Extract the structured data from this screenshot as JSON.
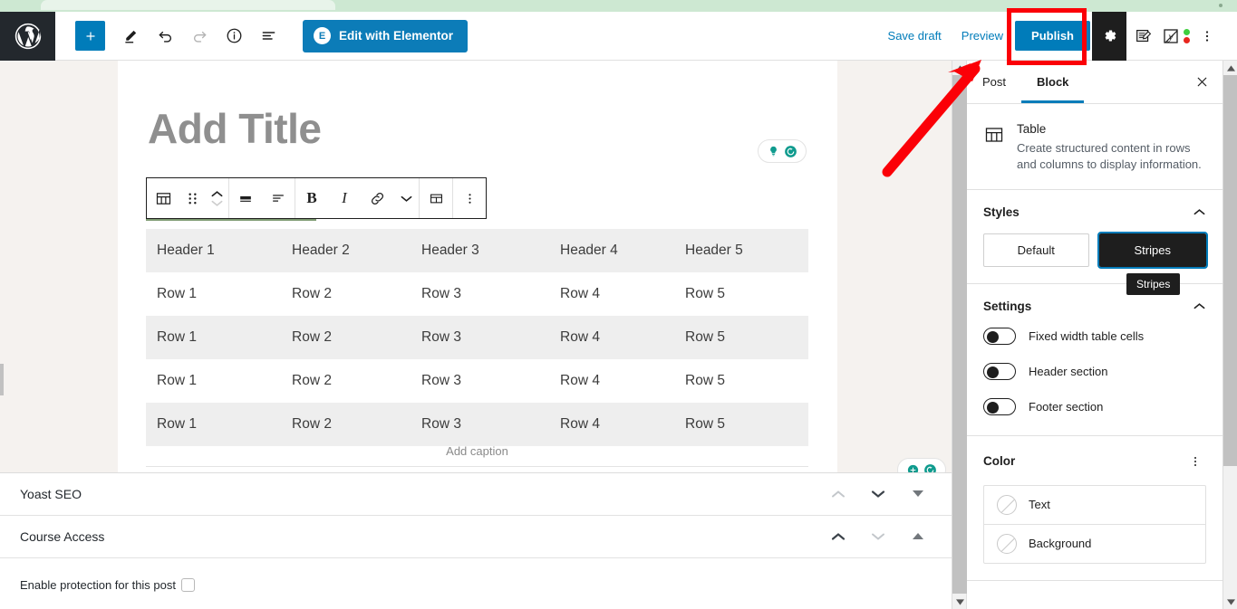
{
  "topbar": {
    "logo_icon": "wordpress-logo-icon",
    "add_block_label": "+",
    "tools": [
      {
        "name": "add-block-button",
        "icon": "plus-icon"
      },
      {
        "name": "tools-pencil-button",
        "icon": "pencil-icon"
      },
      {
        "name": "undo-button",
        "icon": "undo-arrow-icon"
      },
      {
        "name": "redo-button",
        "icon": "redo-arrow-icon"
      },
      {
        "name": "details-button",
        "icon": "info-circle-icon"
      },
      {
        "name": "list-view-button",
        "icon": "list-view-icon"
      }
    ],
    "elementor_label": "Edit with Elementor",
    "elementor_badge": "E",
    "save_draft_label": "Save draft",
    "preview_label": "Preview",
    "publish_label": "Publish",
    "settings_icon": "gear-icon",
    "edit_icon": "edit-note-icon",
    "yoast_icon": "yoast-seo-icon",
    "more_icon": "three-dots-vertical-icon",
    "publish_color": "#007cba",
    "elementor_color": "#0c7cb8"
  },
  "annotation": {
    "highlight_color": "#fb0007",
    "box_target": "publish-button",
    "arrow_points_to": "block-tab"
  },
  "editor": {
    "title_placeholder": "Add Title",
    "caption_placeholder": "Add caption",
    "title_assist_icons": [
      "lightbulb-icon",
      "refresh-circle-icon"
    ],
    "bottom_assist_icons": [
      "plus-circle-icon",
      "refresh-circle-icon"
    ],
    "block_toolbar": [
      {
        "name": "block-type-table-button",
        "icon": "table-icon"
      },
      {
        "name": "drag-handle",
        "icon": "drag-dots-icon"
      },
      {
        "name": "move-block-updown-button",
        "icon": "chevron-up-down-icon"
      },
      {
        "name": "align-button",
        "icon": "align-icon"
      },
      {
        "name": "text-align-button",
        "icon": "text-align-icon"
      },
      {
        "name": "bold-button",
        "icon": "bold-icon",
        "label": "B"
      },
      {
        "name": "italic-button",
        "icon": "italic-icon",
        "label": "I"
      },
      {
        "name": "link-button",
        "icon": "link-chain-icon"
      },
      {
        "name": "more-rich-text-button",
        "icon": "chevron-down-icon"
      },
      {
        "name": "edit-table-button",
        "icon": "table-grid-icon"
      },
      {
        "name": "block-options-button",
        "icon": "three-dots-vertical-icon"
      }
    ]
  },
  "table": {
    "headers": [
      "Header 1",
      "Header 2",
      "Header 3",
      "Header 4",
      "Header 5"
    ],
    "rows": [
      [
        "Row 1",
        "Row 2",
        "Row 3",
        "Row 4",
        "Row 5"
      ],
      [
        "Row 1",
        "Row 2",
        "Row 3",
        "Row 4",
        "Row 5"
      ],
      [
        "Row 1",
        "Row 2",
        "Row 3",
        "Row 4",
        "Row 5"
      ],
      [
        "Row 1",
        "Row 2",
        "Row 3",
        "Row 4",
        "Row 5"
      ]
    ],
    "stripe_color": "#eeeeee"
  },
  "meta_panels": [
    {
      "title": "Yoast SEO",
      "controls": [
        "move-up-icon",
        "move-down-icon",
        "toggle-open-icon"
      ]
    },
    {
      "title": "Course Access",
      "controls": [
        "move-up-icon",
        "move-down-icon",
        "toggle-close-icon"
      ],
      "field_label": "Enable protection for this post",
      "field_checked": false
    }
  ],
  "sidebar": {
    "tabs": [
      {
        "label": "Post",
        "active": false
      },
      {
        "label": "Block",
        "active": true
      }
    ],
    "close_icon": "close-x-icon",
    "block": {
      "icon": "table-icon",
      "name": "Table",
      "description": "Create structured content in rows and columns to display information."
    },
    "styles": {
      "title": "Styles",
      "collapse_icon": "chevron-up-icon",
      "options": [
        {
          "label": "Default",
          "selected": false
        },
        {
          "label": "Stripes",
          "selected": true
        }
      ],
      "tooltip": "Stripes"
    },
    "settings": {
      "title": "Settings",
      "collapse_icon": "chevron-up-icon",
      "toggles": [
        {
          "label": "Fixed width table cells",
          "on": false
        },
        {
          "label": "Header section",
          "on": false
        },
        {
          "label": "Footer section",
          "on": false
        }
      ]
    },
    "color": {
      "title": "Color",
      "menu_icon": "three-dots-vertical-icon",
      "items": [
        {
          "label": "Text"
        },
        {
          "label": "Background"
        }
      ]
    }
  }
}
